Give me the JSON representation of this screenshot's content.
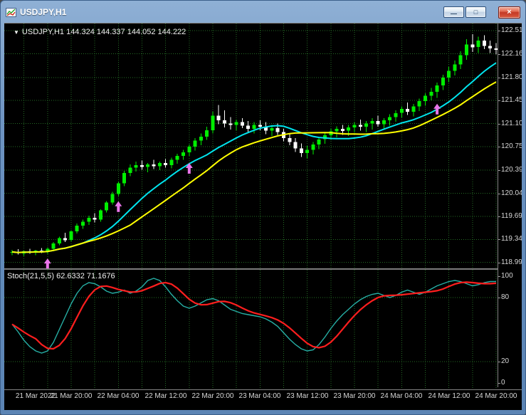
{
  "window": {
    "title": "USDJPY,H1",
    "controls": {
      "minimize_glyph": "—",
      "restore_glyph": "□",
      "close_glyph": "×"
    }
  },
  "chart_data": {
    "type": "candlestick",
    "symbol": "USDJPY",
    "timeframe": "H1",
    "info_line": {
      "marker": "▼",
      "text": "USDJPY,H1 144.324 144.337 144.052 144.222"
    },
    "price_axis": {
      "min": 118.9,
      "max": 122.62,
      "labels": [
        "122.510",
        "122.160",
        "121.800",
        "121.450",
        "121.100",
        "120.750",
        "120.390",
        "120.040",
        "119.690",
        "119.340",
        "118.990"
      ]
    },
    "time_axis": {
      "grid_every": 4,
      "grid_phase": 2,
      "label_indices": [
        2,
        10,
        18,
        26,
        34,
        42,
        50,
        58,
        66,
        74,
        82
      ],
      "labels": [
        "21 Mar 2022",
        "21 Mar 20:00",
        "22 Mar 04:00",
        "22 Mar 12:00",
        "22 Mar 20:00",
        "23 Mar 04:00",
        "23 Mar 12:00",
        "23 Mar 20:00",
        "24 Mar 04:00",
        "24 Mar 12:00",
        "24 Mar 20:00"
      ]
    },
    "colors": {
      "background": "#000000",
      "grid": "#256B25",
      "bull": "#00EE00",
      "bear": "#FFFFFF"
    },
    "candles": [
      [
        119.14,
        119.18,
        119.1,
        119.15
      ],
      [
        119.15,
        119.19,
        119.11,
        119.13
      ],
      [
        119.13,
        119.17,
        119.09,
        119.16
      ],
      [
        119.16,
        119.2,
        119.12,
        119.14
      ],
      [
        119.14,
        119.18,
        119.1,
        119.17
      ],
      [
        119.17,
        119.21,
        119.13,
        119.15
      ],
      [
        119.15,
        119.22,
        119.12,
        119.2
      ],
      [
        119.2,
        119.3,
        119.17,
        119.28
      ],
      [
        119.28,
        119.38,
        119.25,
        119.36
      ],
      [
        119.36,
        119.44,
        119.3,
        119.33
      ],
      [
        119.33,
        119.48,
        119.31,
        119.46
      ],
      [
        119.46,
        119.58,
        119.43,
        119.55
      ],
      [
        119.55,
        119.64,
        119.5,
        119.61
      ],
      [
        119.61,
        119.7,
        119.56,
        119.67
      ],
      [
        119.67,
        119.74,
        119.6,
        119.64
      ],
      [
        119.64,
        119.8,
        119.61,
        119.78
      ],
      [
        119.78,
        119.92,
        119.75,
        119.9
      ],
      [
        119.9,
        120.06,
        119.87,
        120.03
      ],
      [
        120.03,
        120.22,
        120.0,
        120.19
      ],
      [
        120.19,
        120.38,
        120.15,
        120.35
      ],
      [
        120.35,
        120.48,
        120.3,
        120.43
      ],
      [
        120.43,
        120.52,
        120.37,
        120.47
      ],
      [
        120.47,
        120.54,
        120.4,
        120.44
      ],
      [
        120.44,
        120.5,
        120.36,
        120.48
      ],
      [
        120.48,
        120.55,
        120.41,
        120.45
      ],
      [
        120.45,
        120.52,
        120.39,
        120.5
      ],
      [
        120.5,
        120.56,
        120.43,
        120.47
      ],
      [
        120.47,
        120.58,
        120.42,
        120.55
      ],
      [
        120.55,
        120.64,
        120.49,
        120.61
      ],
      [
        120.61,
        120.7,
        120.55,
        120.66
      ],
      [
        120.66,
        120.78,
        120.61,
        120.75
      ],
      [
        120.75,
        120.88,
        120.69,
        120.84
      ],
      [
        120.84,
        120.95,
        120.77,
        120.9
      ],
      [
        120.9,
        121.05,
        120.85,
        121.0
      ],
      [
        121.0,
        121.28,
        120.95,
        121.22
      ],
      [
        121.22,
        121.38,
        121.09,
        121.15
      ],
      [
        121.15,
        121.3,
        121.04,
        121.1
      ],
      [
        121.1,
        121.2,
        121.01,
        121.08
      ],
      [
        121.08,
        121.16,
        121.0,
        121.12
      ],
      [
        121.12,
        121.18,
        121.03,
        121.07
      ],
      [
        121.07,
        121.14,
        120.97,
        121.02
      ],
      [
        121.02,
        121.12,
        120.95,
        121.08
      ],
      [
        121.08,
        121.15,
        121.0,
        121.05
      ],
      [
        121.05,
        121.12,
        120.94,
        120.99
      ],
      [
        120.99,
        121.08,
        120.91,
        121.03
      ],
      [
        121.03,
        121.1,
        120.93,
        120.97
      ],
      [
        120.97,
        121.02,
        120.83,
        120.88
      ],
      [
        120.88,
        120.95,
        120.77,
        120.82
      ],
      [
        120.82,
        120.88,
        120.67,
        120.72
      ],
      [
        120.72,
        120.8,
        120.59,
        120.65
      ],
      [
        120.65,
        120.76,
        120.57,
        120.7
      ],
      [
        120.7,
        120.82,
        120.63,
        120.78
      ],
      [
        120.78,
        120.9,
        120.71,
        120.86
      ],
      [
        120.86,
        120.96,
        120.79,
        120.92
      ],
      [
        120.92,
        121.02,
        120.85,
        120.98
      ],
      [
        120.98,
        121.06,
        120.89,
        121.02
      ],
      [
        121.02,
        121.08,
        120.93,
        120.99
      ],
      [
        120.99,
        121.08,
        120.91,
        121.04
      ],
      [
        121.04,
        121.12,
        120.97,
        121.08
      ],
      [
        121.08,
        121.16,
        120.99,
        121.05
      ],
      [
        121.05,
        121.14,
        120.97,
        121.1
      ],
      [
        121.1,
        121.18,
        121.01,
        121.14
      ],
      [
        121.14,
        121.22,
        121.05,
        121.09
      ],
      [
        121.09,
        121.18,
        121.01,
        121.15
      ],
      [
        121.15,
        121.24,
        121.07,
        121.2
      ],
      [
        121.2,
        121.3,
        121.13,
        121.26
      ],
      [
        121.26,
        121.36,
        121.19,
        121.32
      ],
      [
        121.32,
        121.42,
        121.23,
        121.28
      ],
      [
        121.28,
        121.4,
        121.21,
        121.36
      ],
      [
        121.36,
        121.48,
        121.29,
        121.44
      ],
      [
        121.44,
        121.56,
        121.37,
        121.52
      ],
      [
        121.52,
        121.64,
        121.45,
        121.58
      ],
      [
        121.58,
        121.72,
        121.49,
        121.68
      ],
      [
        121.68,
        121.84,
        121.61,
        121.8
      ],
      [
        121.8,
        121.96,
        121.73,
        121.9
      ],
      [
        121.9,
        122.06,
        121.83,
        122.0
      ],
      [
        122.0,
        122.2,
        121.93,
        122.14
      ],
      [
        122.14,
        122.38,
        122.07,
        122.3
      ],
      [
        122.3,
        122.46,
        122.19,
        122.26
      ],
      [
        122.26,
        122.42,
        122.17,
        122.36
      ],
      [
        122.36,
        122.44,
        122.23,
        122.28
      ],
      [
        122.28,
        122.36,
        122.17,
        122.24
      ],
      [
        122.24,
        122.32,
        122.15,
        122.22
      ]
    ],
    "overlays": [
      {
        "name": "fast-ma",
        "period": 13,
        "color": "#00E5EE"
      },
      {
        "name": "slow-ma",
        "period": 21,
        "color": "#FFFF00"
      }
    ],
    "signals": {
      "color": "#EA75EA",
      "arrows": [
        {
          "index": 6,
          "price": 119.05
        },
        {
          "index": 18,
          "price": 119.92
        },
        {
          "index": 30,
          "price": 120.5
        },
        {
          "index": 72,
          "price": 121.4
        }
      ]
    },
    "indicator": {
      "display_label": "Stoch(21,5,5) 62.6332 71.1676",
      "levels": [
        "100",
        "80",
        "20",
        "0"
      ],
      "level_lines": [
        80,
        20
      ],
      "range": [
        -6,
        106
      ],
      "signal_smoothing": 5,
      "colors": {
        "main": "#26AFA5",
        "signal": "#FF1E1E"
      },
      "main": [
        55,
        48,
        40,
        34,
        30,
        28,
        30,
        38,
        50,
        62,
        74,
        84,
        91,
        94,
        93,
        90,
        86,
        84,
        85,
        87,
        84,
        86,
        90,
        96,
        98,
        96,
        90,
        83,
        77,
        72,
        70,
        72,
        75,
        78,
        79,
        77,
        73,
        69,
        67,
        65,
        64,
        63,
        62,
        60,
        57,
        53,
        47,
        41,
        36,
        32,
        30,
        31,
        36,
        43,
        51,
        58,
        64,
        69,
        74,
        78,
        81,
        83,
        84,
        82,
        80,
        82,
        85,
        87,
        85,
        83,
        85,
        88,
        91,
        93,
        95,
        96,
        95,
        93,
        91,
        92,
        94,
        95,
        95
      ]
    }
  }
}
